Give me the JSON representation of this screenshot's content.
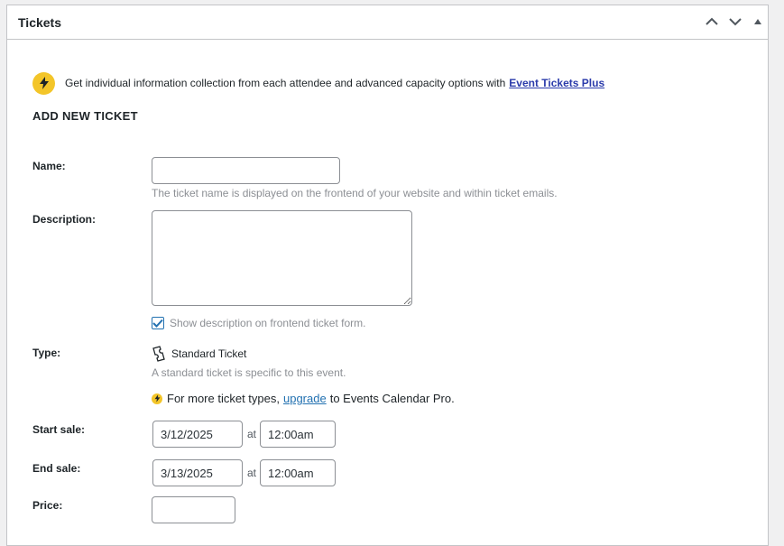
{
  "panel": {
    "title": "Tickets",
    "controls": [
      "chevron-up-icon",
      "chevron-down-icon",
      "triangle-up-icon"
    ]
  },
  "notice": {
    "text": "Get individual information collection from each attendee and advanced capacity options with",
    "link_text": "Event Tickets Plus",
    "icon": "lightning-icon",
    "icon_color": "#f3c529"
  },
  "form": {
    "section_title": "ADD NEW TICKET",
    "name": {
      "label": "Name:",
      "value": "",
      "help": "The ticket name is displayed on the frontend of your website and within ticket emails."
    },
    "description": {
      "label": "Description:",
      "value": "",
      "show_checkbox_label": "Show description on frontend ticket form.",
      "show_checked": true
    },
    "type": {
      "label": "Type:",
      "value": "Standard Ticket",
      "help": "A standard ticket is specific to this event.",
      "upsell_prefix": "For more ticket types,",
      "upsell_link": "upgrade",
      "upsell_suffix": "to Events Calendar Pro."
    },
    "start_sale": {
      "label": "Start sale:",
      "date": "3/12/2025",
      "at": "at",
      "time": "12:00am"
    },
    "end_sale": {
      "label": "End sale:",
      "date": "3/13/2025",
      "at": "at",
      "time": "12:00am"
    },
    "price": {
      "label": "Price:",
      "value": ""
    }
  },
  "colors": {
    "link": "#2271b1",
    "notice_link": "#2b3bab",
    "help_text": "#8c8f94",
    "checkbox": "#2271b1"
  }
}
